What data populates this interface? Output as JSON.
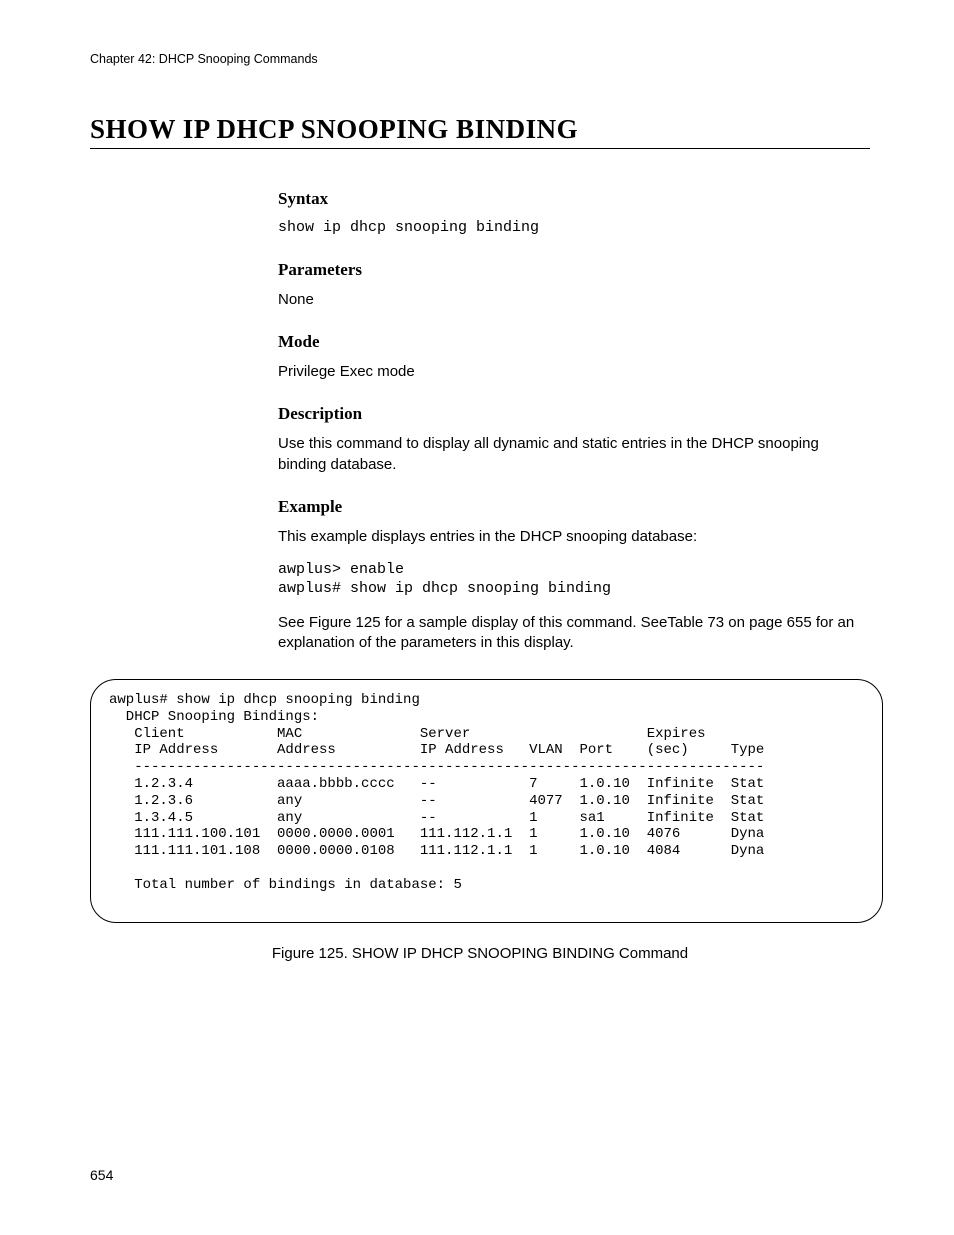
{
  "chapter_header": "Chapter 42: DHCP Snooping Commands",
  "title": "SHOW IP DHCP SNOOPING BINDING",
  "sections": {
    "syntax": {
      "heading": "Syntax",
      "code": "show ip dhcp snooping binding"
    },
    "parameters": {
      "heading": "Parameters",
      "text": "None"
    },
    "mode": {
      "heading": "Mode",
      "text": "Privilege Exec mode"
    },
    "description": {
      "heading": "Description",
      "text": "Use this command to display all dynamic and static entries in the DHCP snooping binding database."
    },
    "example": {
      "heading": "Example",
      "intro": "This example displays entries in the DHCP snooping database:",
      "code": "awplus> enable\nawplus# show ip dhcp snooping binding",
      "after": "See Figure 125 for a sample display of this command. SeeTable 73 on page 655 for an explanation of the parameters in this display."
    }
  },
  "terminal_output": "awplus# show ip dhcp snooping binding\n  DHCP Snooping Bindings:\n   Client           MAC              Server                     Expires\n   IP Address       Address          IP Address   VLAN  Port    (sec)     Type\n   ---------------------------------------------------------------------------\n   1.2.3.4          aaaa.bbbb.cccc   --           7     1.0.10  Infinite  Stat\n   1.2.3.6          any              --           4077  1.0.10  Infinite  Stat\n   1.3.4.5          any              --           1     sa1     Infinite  Stat\n   111.111.100.101  0000.0000.0001   111.112.1.1  1     1.0.10  4076      Dyna\n   111.111.101.108  0000.0000.0108   111.112.1.1  1     1.0.10  4084      Dyna\n\n   Total number of bindings in database: 5",
  "figure_caption": "Figure 125. SHOW IP DHCP SNOOPING BINDING Command",
  "page_number": "654"
}
